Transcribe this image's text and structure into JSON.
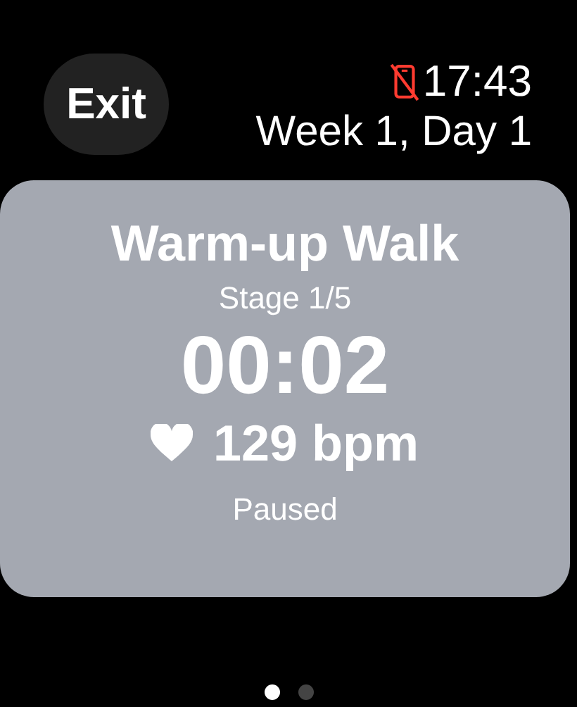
{
  "exit_button": {
    "label": "Exit"
  },
  "status": {
    "phone_disconnected": true,
    "time": "17:43"
  },
  "subtitle": "Week 1, Day 1",
  "workout": {
    "title": "Warm-up Walk",
    "stage": "Stage 1/5",
    "elapsed": "00:02",
    "heart_rate": "129 bpm",
    "state": "Paused"
  },
  "pages": [
    {
      "selected": true
    },
    {
      "selected": false
    }
  ]
}
